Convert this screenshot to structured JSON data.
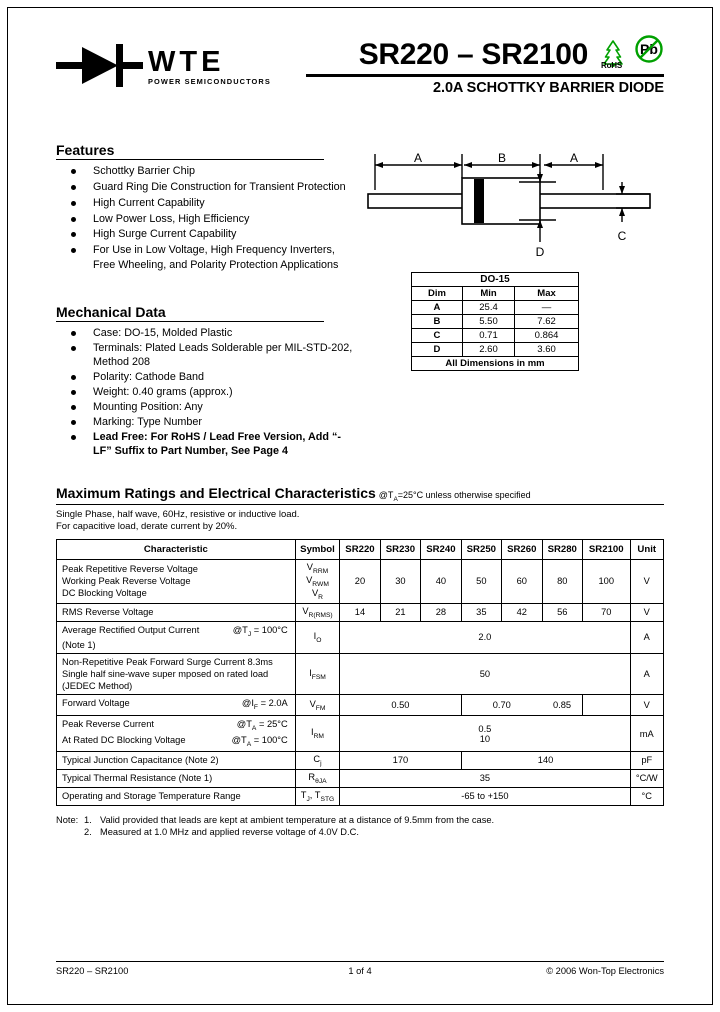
{
  "brand": {
    "name": "WTE",
    "tagline": "POWER SEMICONDUCTORS",
    "logo_icon": "diode-symbol-icon"
  },
  "header": {
    "title": "SR220 – SR2100",
    "subtitle": "2.0A SCHOTTKY BARRIER DIODE",
    "rohs_label": "RoHS",
    "rohs_icon": "green-tree-icon",
    "pb_free_icon": "lead-free-pb-icon",
    "pb_text": "Pb",
    "accent_color": "#00A000"
  },
  "features": {
    "heading": "Features",
    "items": [
      "Schottky Barrier Chip",
      "Guard Ring Die Construction for Transient Protection",
      "High Current Capability",
      "Low Power Loss, High Efficiency",
      "High Surge Current Capability",
      "For Use in Low Voltage, High Frequency Inverters, Free Wheeling, and Polarity Protection Applications"
    ]
  },
  "mechanical": {
    "heading": "Mechanical Data",
    "items": [
      {
        "text": "Case: DO-15, Molded Plastic",
        "bold": false
      },
      {
        "text": "Terminals: Plated Leads Solderable per MIL-STD-202, Method 208",
        "bold": false
      },
      {
        "text": "Polarity: Cathode Band",
        "bold": false
      },
      {
        "text": "Weight: 0.40 grams (approx.)",
        "bold": false
      },
      {
        "text": "Mounting Position: Any",
        "bold": false
      },
      {
        "text": "Marking: Type Number",
        "bold": false
      },
      {
        "text": "Lead Free: For RoHS / Lead Free Version, Add “-LF” Suffix to Part Number, See Page 4",
        "bold": true
      }
    ]
  },
  "package_drawing": {
    "labels": [
      "A",
      "B",
      "A",
      "D",
      "C"
    ],
    "case": "DO-15"
  },
  "dim_table": {
    "title": "DO-15",
    "columns": [
      "Dim",
      "Min",
      "Max"
    ],
    "rows": [
      {
        "dim": "A",
        "min": "25.4",
        "max": "—"
      },
      {
        "dim": "B",
        "min": "5.50",
        "max": "7.62"
      },
      {
        "dim": "C",
        "min": "0.71",
        "max": "0.864"
      },
      {
        "dim": "D",
        "min": "2.60",
        "max": "3.60"
      }
    ],
    "footer": "All Dimensions in mm"
  },
  "ratings": {
    "heading": "Maximum Ratings and Electrical Characteristics",
    "condition": "@TA=25°C unless otherwise specified",
    "note_line1": "Single Phase, half wave, 60Hz, resistive or inductive load.",
    "note_line2": "For capacitive load, derate current by 20%.",
    "columns": [
      "Characteristic",
      "Symbol",
      "SR220",
      "SR230",
      "SR240",
      "SR250",
      "SR260",
      "SR280",
      "SR2100",
      "Unit"
    ],
    "rows": [
      {
        "characteristic_lines": [
          "Peak Repetitive Reverse Voltage",
          "Working Peak Reverse Voltage",
          "DC Blocking Voltage"
        ],
        "symbol_lines": [
          "VRRM",
          "VRWM",
          "VR"
        ],
        "values": [
          "20",
          "30",
          "40",
          "50",
          "60",
          "80",
          "100"
        ],
        "unit": "V"
      },
      {
        "characteristic_lines": [
          "RMS Reverse Voltage"
        ],
        "symbol_lines": [
          "VR(RMS)"
        ],
        "values": [
          "14",
          "21",
          "28",
          "35",
          "42",
          "56",
          "70"
        ],
        "unit": "V"
      },
      {
        "characteristic_lines": [
          "Average Rectified Output Current",
          "(Note 1)"
        ],
        "characteristic_cond": "@TJ = 100°C",
        "symbol_lines": [
          "IO"
        ],
        "span_value": "2.0",
        "unit": "A"
      },
      {
        "characteristic_lines": [
          "Non-Repetitive Peak Forward Surge Current 8.3ms",
          "Single half sine-wave super mposed on rated load",
          "(JEDEC Method)"
        ],
        "symbol_lines": [
          "IFSM"
        ],
        "span_value": "50",
        "unit": "A"
      },
      {
        "characteristic_lines": [
          "Forward Voltage"
        ],
        "characteristic_cond": "@IF = 2.0A",
        "symbol_lines": [
          "VFM"
        ],
        "group_values": [
          "0.50",
          "0.70",
          "0.85"
        ],
        "unit": "V"
      },
      {
        "characteristic_lines": [
          "Peak Reverse Current",
          "At Rated DC Blocking Voltage"
        ],
        "characteristic_cond_lines": [
          "@TA = 25°C",
          "@TA = 100°C"
        ],
        "symbol_lines": [
          "IRM"
        ],
        "span_value_lines": [
          "0.5",
          "10"
        ],
        "unit": "mA"
      },
      {
        "characteristic_lines": [
          "Typical Junction Capacitance (Note 2)"
        ],
        "symbol_lines": [
          "Cj"
        ],
        "cj_values": [
          "170",
          "140"
        ],
        "unit": "pF"
      },
      {
        "characteristic_lines": [
          "Typical Thermal Resistance (Note 1)"
        ],
        "symbol_lines": [
          "RθJA"
        ],
        "span_value": "35",
        "unit": "°C/W"
      },
      {
        "characteristic_lines": [
          "Operating and Storage Temperature Range"
        ],
        "symbol_lines": [
          "TJ, TSTG"
        ],
        "span_value": "-65 to +150",
        "unit": "°C"
      }
    ]
  },
  "notes": {
    "label": "Note:",
    "items": [
      {
        "num": "1.",
        "text": "Valid provided that leads are kept at ambient temperature at a distance of 9.5mm from the case."
      },
      {
        "num": "2.",
        "text": "Measured at 1.0 MHz and applied reverse voltage of 4.0V D.C."
      }
    ]
  },
  "footer": {
    "left": "SR220 – SR2100",
    "center": "1 of 4",
    "right": "© 2006 Won-Top Electronics"
  }
}
